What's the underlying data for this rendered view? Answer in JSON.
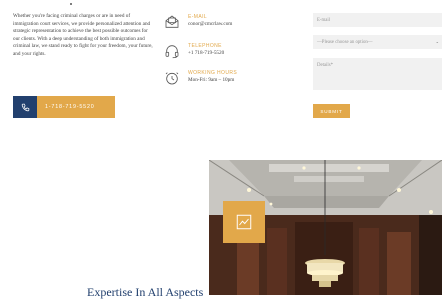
{
  "intro": {
    "text": "Whether you're facing criminal charges or are in need of immigration court services, we provide personalized attention and strategic representation to achieve the best possible outcomes for our clients. With a deep understanding of both immigration and criminal law, we stand ready to fight for your freedom, your future, and your rights."
  },
  "cta": {
    "label": "1-718-719-5520",
    "icon": "phone-icon"
  },
  "contact": {
    "email": {
      "label": "E-MAIL",
      "value": "conor@cmcrlaw.com",
      "icon": "email-icon"
    },
    "phone": {
      "label": "TELEPHONE",
      "value": "+1 718-719-5520",
      "icon": "headset-icon"
    },
    "hours": {
      "label": "WORKING HOURS",
      "value": "Mon-Fri: 9am – 10pm",
      "icon": "clock-icon"
    }
  },
  "form": {
    "email_placeholder": "E-mail",
    "select_value": "—Please choose an option—",
    "details_placeholder": "Details*",
    "submit_label": "SUBMIT"
  },
  "section": {
    "heading": "Expertise In All Aspects"
  },
  "colors": {
    "accent": "#e2a84a",
    "navy": "#22406e",
    "field": "#f1f1f1"
  }
}
